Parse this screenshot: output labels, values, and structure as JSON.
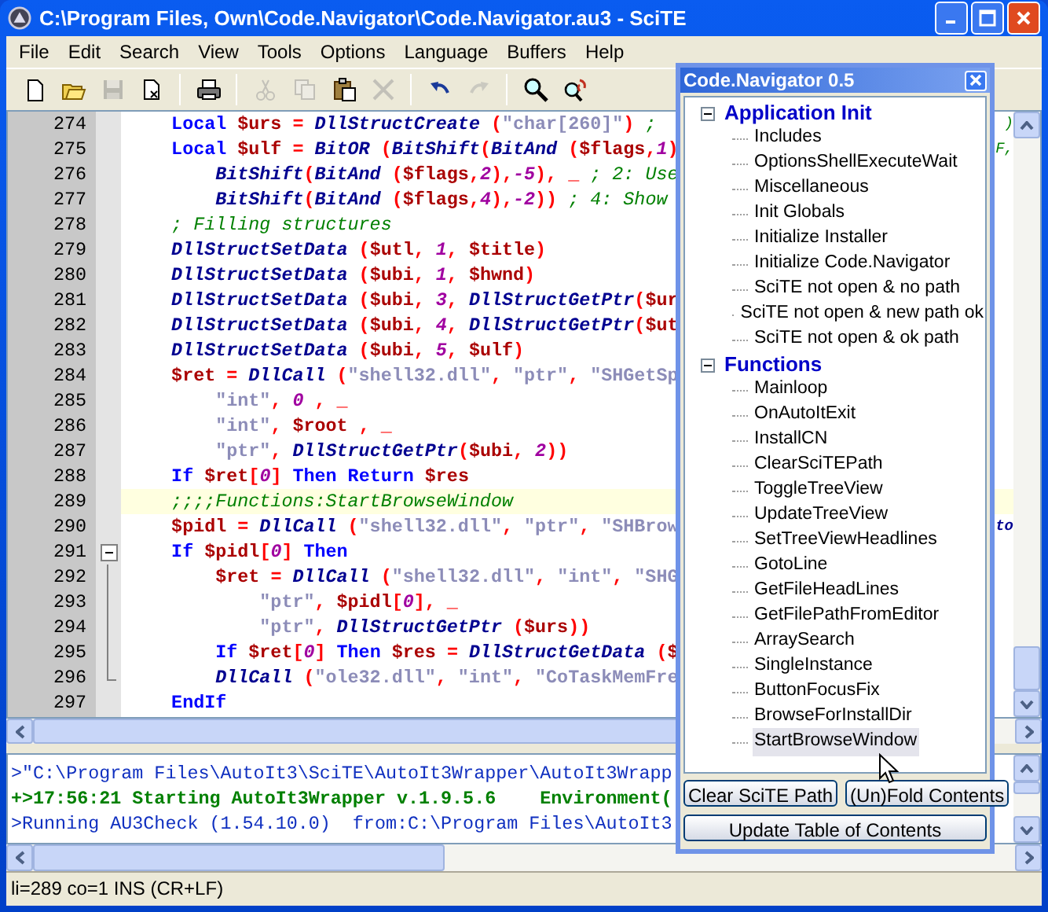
{
  "window": {
    "title": "C:\\Program Files, Own\\Code.Navigator\\Code.Navigator.au3 - SciTE"
  },
  "menu": [
    "File",
    "Edit",
    "Search",
    "View",
    "Tools",
    "Options",
    "Language",
    "Buffers",
    "Help"
  ],
  "toolbar": [
    {
      "kind": "new",
      "disabled": false
    },
    {
      "kind": "open",
      "disabled": false
    },
    {
      "kind": "save",
      "disabled": true
    },
    {
      "kind": "close",
      "disabled": false
    },
    {
      "kind": "sep"
    },
    {
      "kind": "print",
      "disabled": false
    },
    {
      "kind": "sep"
    },
    {
      "kind": "cut",
      "disabled": true
    },
    {
      "kind": "copy",
      "disabled": true
    },
    {
      "kind": "paste",
      "disabled": false
    },
    {
      "kind": "delete",
      "disabled": true
    },
    {
      "kind": "sep"
    },
    {
      "kind": "undo",
      "disabled": false
    },
    {
      "kind": "redo",
      "disabled": true
    },
    {
      "kind": "sep"
    },
    {
      "kind": "find",
      "disabled": false
    },
    {
      "kind": "replace",
      "disabled": false
    }
  ],
  "editor": {
    "lines": [
      {
        "number": "274",
        "current": false,
        "fold_start": false,
        "fold_end": false,
        "tokens": [
          {
            "kind": "keyword",
            "text": "    Local "
          },
          {
            "kind": "variable",
            "text": "$urs "
          },
          {
            "kind": "operator",
            "text": "= "
          },
          {
            "kind": "function",
            "text": "DllStructCreate "
          },
          {
            "kind": "operator",
            "text": "("
          },
          {
            "kind": "string",
            "text": "\"char[260]\""
          },
          {
            "kind": "operator",
            "text": ") "
          },
          {
            "kind": "comment",
            "text": ";"
          }
        ],
        "right_fragment": {
          "kind": "comment",
          "text": ")"
        }
      },
      {
        "number": "275",
        "current": false,
        "fold_start": false,
        "fold_end": false,
        "tokens": [
          {
            "kind": "keyword",
            "text": "    Local "
          },
          {
            "kind": "variable",
            "text": "$ulf "
          },
          {
            "kind": "operator",
            "text": "= "
          },
          {
            "kind": "function",
            "text": "BitOR "
          },
          {
            "kind": "operator",
            "text": "("
          },
          {
            "kind": "function",
            "text": "BitShift"
          },
          {
            "kind": "operator",
            "text": "("
          },
          {
            "kind": "function",
            "text": "BitAnd "
          },
          {
            "kind": "operator",
            "text": "("
          },
          {
            "kind": "variable",
            "text": "$flags"
          },
          {
            "kind": "operator",
            "text": ","
          },
          {
            "kind": "number",
            "text": "1"
          },
          {
            "kind": "operator",
            "text": ")"
          }
        ],
        "right_fragment": {
          "kind": "comment",
          "text": "F,"
        }
      },
      {
        "number": "276",
        "current": false,
        "fold_start": false,
        "fold_end": false,
        "tokens": [
          {
            "kind": "function",
            "text": "        BitShift"
          },
          {
            "kind": "operator",
            "text": "("
          },
          {
            "kind": "function",
            "text": "BitAnd "
          },
          {
            "kind": "operator",
            "text": "("
          },
          {
            "kind": "variable",
            "text": "$flags"
          },
          {
            "kind": "operator",
            "text": ","
          },
          {
            "kind": "number",
            "text": "2"
          },
          {
            "kind": "operator",
            "text": "),"
          },
          {
            "kind": "number",
            "text": "-5"
          },
          {
            "kind": "operator",
            "text": "), _ "
          },
          {
            "kind": "comment",
            "text": "; 2: Use"
          }
        ]
      },
      {
        "number": "277",
        "current": false,
        "fold_start": false,
        "fold_end": false,
        "tokens": [
          {
            "kind": "function",
            "text": "        BitShift"
          },
          {
            "kind": "operator",
            "text": "("
          },
          {
            "kind": "function",
            "text": "BitAnd "
          },
          {
            "kind": "operator",
            "text": "("
          },
          {
            "kind": "variable",
            "text": "$flags"
          },
          {
            "kind": "operator",
            "text": ","
          },
          {
            "kind": "number",
            "text": "4"
          },
          {
            "kind": "operator",
            "text": "),"
          },
          {
            "kind": "number",
            "text": "-2"
          },
          {
            "kind": "operator",
            "text": ")) "
          },
          {
            "kind": "comment",
            "text": "; 4: Show"
          }
        ]
      },
      {
        "number": "278",
        "current": false,
        "fold_start": false,
        "fold_end": false,
        "tokens": [
          {
            "kind": "comment",
            "text": "    ; Filling structures"
          }
        ]
      },
      {
        "number": "279",
        "current": false,
        "fold_start": false,
        "fold_end": false,
        "tokens": [
          {
            "kind": "function",
            "text": "    DllStructSetData "
          },
          {
            "kind": "operator",
            "text": "("
          },
          {
            "kind": "variable",
            "text": "$utl"
          },
          {
            "kind": "operator",
            "text": ", "
          },
          {
            "kind": "number",
            "text": "1"
          },
          {
            "kind": "operator",
            "text": ", "
          },
          {
            "kind": "variable",
            "text": "$title"
          },
          {
            "kind": "operator",
            "text": ")"
          }
        ]
      },
      {
        "number": "280",
        "current": false,
        "fold_start": false,
        "fold_end": false,
        "tokens": [
          {
            "kind": "function",
            "text": "    DllStructSetData "
          },
          {
            "kind": "operator",
            "text": "("
          },
          {
            "kind": "variable",
            "text": "$ubi"
          },
          {
            "kind": "operator",
            "text": ", "
          },
          {
            "kind": "number",
            "text": "1"
          },
          {
            "kind": "operator",
            "text": ", "
          },
          {
            "kind": "variable",
            "text": "$hwnd"
          },
          {
            "kind": "operator",
            "text": ")"
          }
        ]
      },
      {
        "number": "281",
        "current": false,
        "fold_start": false,
        "fold_end": false,
        "tokens": [
          {
            "kind": "function",
            "text": "    DllStructSetData "
          },
          {
            "kind": "operator",
            "text": "("
          },
          {
            "kind": "variable",
            "text": "$ubi"
          },
          {
            "kind": "operator",
            "text": ", "
          },
          {
            "kind": "number",
            "text": "3"
          },
          {
            "kind": "operator",
            "text": ", "
          },
          {
            "kind": "function",
            "text": "DllStructGetPtr"
          },
          {
            "kind": "operator",
            "text": "("
          },
          {
            "kind": "variable",
            "text": "$ur"
          }
        ]
      },
      {
        "number": "282",
        "current": false,
        "fold_start": false,
        "fold_end": false,
        "tokens": [
          {
            "kind": "function",
            "text": "    DllStructSetData "
          },
          {
            "kind": "operator",
            "text": "("
          },
          {
            "kind": "variable",
            "text": "$ubi"
          },
          {
            "kind": "operator",
            "text": ", "
          },
          {
            "kind": "number",
            "text": "4"
          },
          {
            "kind": "operator",
            "text": ", "
          },
          {
            "kind": "function",
            "text": "DllStructGetPtr"
          },
          {
            "kind": "operator",
            "text": "("
          },
          {
            "kind": "variable",
            "text": "$ut"
          }
        ]
      },
      {
        "number": "283",
        "current": false,
        "fold_start": false,
        "fold_end": false,
        "tokens": [
          {
            "kind": "function",
            "text": "    DllStructSetData "
          },
          {
            "kind": "operator",
            "text": "("
          },
          {
            "kind": "variable",
            "text": "$ubi"
          },
          {
            "kind": "operator",
            "text": ", "
          },
          {
            "kind": "number",
            "text": "5"
          },
          {
            "kind": "operator",
            "text": ", "
          },
          {
            "kind": "variable",
            "text": "$ulf"
          },
          {
            "kind": "operator",
            "text": ")"
          }
        ]
      },
      {
        "number": "284",
        "current": false,
        "fold_start": false,
        "fold_end": false,
        "tokens": [
          {
            "kind": "variable",
            "text": "    $ret "
          },
          {
            "kind": "operator",
            "text": "= "
          },
          {
            "kind": "function",
            "text": "DllCall "
          },
          {
            "kind": "operator",
            "text": "("
          },
          {
            "kind": "string",
            "text": "\"shell32.dll\""
          },
          {
            "kind": "operator",
            "text": ", "
          },
          {
            "kind": "string",
            "text": "\"ptr\""
          },
          {
            "kind": "operator",
            "text": ", "
          },
          {
            "kind": "string",
            "text": "\"SHGetSp"
          }
        ]
      },
      {
        "number": "285",
        "current": false,
        "fold_start": false,
        "fold_end": false,
        "tokens": [
          {
            "kind": "string",
            "text": "        \"int\""
          },
          {
            "kind": "operator",
            "text": ", "
          },
          {
            "kind": "number",
            "text": "0 "
          },
          {
            "kind": "operator",
            "text": ", _"
          }
        ]
      },
      {
        "number": "286",
        "current": false,
        "fold_start": false,
        "fold_end": false,
        "tokens": [
          {
            "kind": "string",
            "text": "        \"int\""
          },
          {
            "kind": "operator",
            "text": ", "
          },
          {
            "kind": "variable",
            "text": "$root "
          },
          {
            "kind": "operator",
            "text": ", _"
          }
        ]
      },
      {
        "number": "287",
        "current": false,
        "fold_start": false,
        "fold_end": false,
        "tokens": [
          {
            "kind": "string",
            "text": "        \"ptr\""
          },
          {
            "kind": "operator",
            "text": ", "
          },
          {
            "kind": "function",
            "text": "DllStructGetPtr"
          },
          {
            "kind": "operator",
            "text": "("
          },
          {
            "kind": "variable",
            "text": "$ubi"
          },
          {
            "kind": "operator",
            "text": ", "
          },
          {
            "kind": "number",
            "text": "2"
          },
          {
            "kind": "operator",
            "text": "))"
          }
        ]
      },
      {
        "number": "288",
        "current": false,
        "fold_start": false,
        "fold_end": false,
        "tokens": [
          {
            "kind": "keyword",
            "text": "    If "
          },
          {
            "kind": "variable",
            "text": "$ret"
          },
          {
            "kind": "operator",
            "text": "["
          },
          {
            "kind": "number",
            "text": "0"
          },
          {
            "kind": "operator",
            "text": "] "
          },
          {
            "kind": "keyword",
            "text": "Then Return "
          },
          {
            "kind": "variable",
            "text": "$res"
          }
        ]
      },
      {
        "number": "289",
        "current": true,
        "fold_start": false,
        "fold_end": false,
        "tokens": [
          {
            "kind": "comment",
            "text": "    ;;;;Functions:StartBrowseWindow"
          }
        ]
      },
      {
        "number": "290",
        "current": false,
        "fold_start": false,
        "fold_end": false,
        "tokens": [
          {
            "kind": "variable",
            "text": "    $pidl "
          },
          {
            "kind": "operator",
            "text": "= "
          },
          {
            "kind": "function",
            "text": "DllCall "
          },
          {
            "kind": "operator",
            "text": "("
          },
          {
            "kind": "string",
            "text": "\"shell32.dll\""
          },
          {
            "kind": "operator",
            "text": ", "
          },
          {
            "kind": "string",
            "text": "\"ptr\""
          },
          {
            "kind": "operator",
            "text": ", "
          },
          {
            "kind": "string",
            "text": "\"SHBrow"
          }
        ],
        "right_fragment": {
          "kind": "function",
          "text": "to"
        }
      },
      {
        "number": "291",
        "current": false,
        "fold_start": true,
        "fold_end": false,
        "tokens": [
          {
            "kind": "keyword",
            "text": "    If "
          },
          {
            "kind": "variable",
            "text": "$pidl"
          },
          {
            "kind": "operator",
            "text": "["
          },
          {
            "kind": "number",
            "text": "0"
          },
          {
            "kind": "operator",
            "text": "] "
          },
          {
            "kind": "keyword",
            "text": "Then"
          }
        ]
      },
      {
        "number": "292",
        "current": false,
        "fold_start": false,
        "fold_end": false,
        "tokens": [
          {
            "kind": "variable",
            "text": "        $ret "
          },
          {
            "kind": "operator",
            "text": "= "
          },
          {
            "kind": "function",
            "text": "DllCall "
          },
          {
            "kind": "operator",
            "text": "("
          },
          {
            "kind": "string",
            "text": "\"shell32.dll\""
          },
          {
            "kind": "operator",
            "text": ", "
          },
          {
            "kind": "string",
            "text": "\"int\""
          },
          {
            "kind": "operator",
            "text": ", "
          },
          {
            "kind": "string",
            "text": "\"SHG"
          }
        ]
      },
      {
        "number": "293",
        "current": false,
        "fold_start": false,
        "fold_end": false,
        "tokens": [
          {
            "kind": "string",
            "text": "            \"ptr\""
          },
          {
            "kind": "operator",
            "text": ", "
          },
          {
            "kind": "variable",
            "text": "$pidl"
          },
          {
            "kind": "operator",
            "text": "["
          },
          {
            "kind": "number",
            "text": "0"
          },
          {
            "kind": "operator",
            "text": "], _"
          }
        ]
      },
      {
        "number": "294",
        "current": false,
        "fold_start": false,
        "fold_end": false,
        "tokens": [
          {
            "kind": "string",
            "text": "            \"ptr\""
          },
          {
            "kind": "operator",
            "text": ", "
          },
          {
            "kind": "function",
            "text": "DllStructGetPtr "
          },
          {
            "kind": "operator",
            "text": "("
          },
          {
            "kind": "variable",
            "text": "$urs"
          },
          {
            "kind": "operator",
            "text": "))"
          }
        ]
      },
      {
        "number": "295",
        "current": false,
        "fold_start": false,
        "fold_end": false,
        "tokens": [
          {
            "kind": "keyword",
            "text": "        If "
          },
          {
            "kind": "variable",
            "text": "$ret"
          },
          {
            "kind": "operator",
            "text": "["
          },
          {
            "kind": "number",
            "text": "0"
          },
          {
            "kind": "operator",
            "text": "] "
          },
          {
            "kind": "keyword",
            "text": "Then "
          },
          {
            "kind": "variable",
            "text": "$res "
          },
          {
            "kind": "operator",
            "text": "= "
          },
          {
            "kind": "function",
            "text": "DllStructGetData "
          },
          {
            "kind": "operator",
            "text": "("
          },
          {
            "kind": "variable",
            "text": "$"
          }
        ]
      },
      {
        "number": "296",
        "current": false,
        "fold_start": false,
        "fold_end": true,
        "tokens": [
          {
            "kind": "function",
            "text": "        DllCall "
          },
          {
            "kind": "operator",
            "text": "("
          },
          {
            "kind": "string",
            "text": "\"ole32.dll\""
          },
          {
            "kind": "operator",
            "text": ", "
          },
          {
            "kind": "string",
            "text": "\"int\""
          },
          {
            "kind": "operator",
            "text": ", "
          },
          {
            "kind": "string",
            "text": "\"CoTaskMemFre"
          }
        ]
      },
      {
        "number": "297",
        "current": false,
        "fold_start": false,
        "fold_end": false,
        "tokens": [
          {
            "kind": "keyword",
            "text": "    EndIf"
          }
        ]
      }
    ]
  },
  "output": {
    "lines": [
      {
        "kind": "command",
        "text": ">\"C:\\Program Files\\AutoIt3\\SciTE\\AutoIt3Wrapper\\AutoIt3Wrapp"
      },
      {
        "kind": "success",
        "text": "+>17:56:21 Starting AutoIt3Wrapper v.1.9.5.6    Environment("
      },
      {
        "kind": "command",
        "text": ">Running AU3Check (1.54.10.0)  from:C:\\Program Files\\AutoIt3"
      }
    ]
  },
  "status_bar": "li=289 co=1 INS (CR+LF)",
  "navigator": {
    "title": "Code.Navigator 0.5",
    "tree": [
      {
        "label": "Application Init",
        "expanded": true,
        "selected": false,
        "children": [
          {
            "label": "Includes",
            "selected": false
          },
          {
            "label": "OptionsShellExecuteWait",
            "selected": false
          },
          {
            "label": "Miscellaneous",
            "selected": false
          },
          {
            "label": "Init Globals",
            "selected": false
          },
          {
            "label": "Initialize Installer",
            "selected": false
          },
          {
            "label": "Initialize Code.Navigator",
            "selected": false
          },
          {
            "label": "SciTE not open & no path",
            "selected": false
          },
          {
            "label": "SciTE not open & new path ok",
            "selected": false
          },
          {
            "label": "SciTE not open & ok path",
            "selected": false
          }
        ]
      },
      {
        "label": "Functions",
        "expanded": true,
        "selected": false,
        "children": [
          {
            "label": "Mainloop",
            "selected": false
          },
          {
            "label": "OnAutoItExit",
            "selected": false
          },
          {
            "label": "InstallCN",
            "selected": false
          },
          {
            "label": "ClearSciTEPath",
            "selected": false
          },
          {
            "label": "ToggleTreeView",
            "selected": false
          },
          {
            "label": "UpdateTreeView",
            "selected": false
          },
          {
            "label": "SetTreeViewHeadlines",
            "selected": false
          },
          {
            "label": "GotoLine",
            "selected": false
          },
          {
            "label": "GetFileHeadLines",
            "selected": false
          },
          {
            "label": "GetFilePathFromEditor",
            "selected": false
          },
          {
            "label": "ArraySearch",
            "selected": false
          },
          {
            "label": "SingleInstance",
            "selected": false
          },
          {
            "label": "ButtonFocusFix",
            "selected": false
          },
          {
            "label": "BrowseForInstallDir",
            "selected": false
          },
          {
            "label": "StartBrowseWindow",
            "selected": true
          }
        ]
      }
    ],
    "buttons": [
      "Clear SciTE Path",
      "(Un)Fold Contents"
    ],
    "wide_button": "Update Table of Contents"
  }
}
